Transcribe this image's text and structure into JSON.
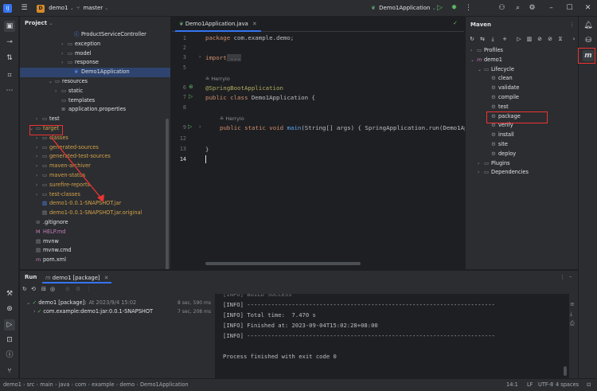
{
  "titlebar": {
    "app_icon": "ij-logo-icon",
    "project_badge": "D",
    "project_name": "demo1",
    "branch": "master",
    "run_config": "Demo1Application"
  },
  "project_panel": {
    "title": "Project",
    "rows": [
      {
        "label": "ProductServiceController",
        "indent": 7,
        "icon": "class-icon",
        "arrow": ""
      },
      {
        "label": "exception",
        "indent": 6,
        "icon": "folder-icon",
        "arrow": ">"
      },
      {
        "label": "model",
        "indent": 6,
        "icon": "folder-icon",
        "arrow": ">"
      },
      {
        "label": "response",
        "indent": 6,
        "icon": "folder-icon",
        "arrow": ">"
      },
      {
        "label": "Demo1Application",
        "indent": 7,
        "icon": "spring-class-icon",
        "arrow": "",
        "selected": true
      },
      {
        "label": "resources",
        "indent": 4,
        "icon": "folder-icon",
        "arrow": "v"
      },
      {
        "label": "static",
        "indent": 5,
        "icon": "folder-icon",
        "arrow": ">"
      },
      {
        "label": "templates",
        "indent": 5,
        "icon": "folder-icon",
        "arrow": ""
      },
      {
        "label": "application.properties",
        "indent": 5,
        "icon": "properties-icon",
        "arrow": ""
      },
      {
        "label": "test",
        "indent": 2,
        "icon": "folder-icon",
        "arrow": ">"
      },
      {
        "label": "target",
        "indent": 1,
        "icon": "folder-icon",
        "arrow": "v",
        "target": true
      },
      {
        "label": "classes",
        "indent": 2,
        "icon": "folder-icon",
        "arrow": ">",
        "target": true
      },
      {
        "label": "generated-sources",
        "indent": 2,
        "icon": "folder-icon",
        "arrow": ">",
        "target": true
      },
      {
        "label": "generated-test-sources",
        "indent": 2,
        "icon": "folder-icon",
        "arrow": ">",
        "target": true
      },
      {
        "label": "maven-archiver",
        "indent": 2,
        "icon": "folder-icon",
        "arrow": ">",
        "target": true
      },
      {
        "label": "maven-status",
        "indent": 2,
        "icon": "folder-icon",
        "arrow": ">",
        "target": true
      },
      {
        "label": "surefire-reports",
        "indent": 2,
        "icon": "folder-icon",
        "arrow": ">",
        "target": true
      },
      {
        "label": "test-classes",
        "indent": 2,
        "icon": "folder-icon",
        "arrow": ">",
        "target": true
      },
      {
        "label": "demo1-0.0.1-SNAPSHOT.jar",
        "indent": 2,
        "icon": "jar-icon",
        "arrow": "",
        "target": true
      },
      {
        "label": "demo1-0.0.1-SNAPSHOT.jar.original",
        "indent": 2,
        "icon": "file-icon",
        "arrow": "",
        "target": true
      },
      {
        "label": ".gitignore",
        "indent": 1,
        "icon": "gitignore-icon",
        "arrow": ""
      },
      {
        "label": "HELP.md",
        "indent": 1,
        "icon": "markdown-icon",
        "arrow": "",
        "help": true
      },
      {
        "label": "mvnw",
        "indent": 1,
        "icon": "file-icon",
        "arrow": ""
      },
      {
        "label": "mvnw.cmd",
        "indent": 1,
        "icon": "file-icon",
        "arrow": ""
      },
      {
        "label": "pom.xml",
        "indent": 1,
        "icon": "maven-icon",
        "arrow": ""
      }
    ]
  },
  "editor": {
    "tab_label": "Demo1Application.java",
    "line_numbers": [
      "1",
      "2",
      "3",
      "5",
      "6",
      "7",
      "8",
      "9",
      "12",
      "13",
      "14"
    ],
    "code": {
      "l1_kw": "package",
      "l1_rest": " com.example.demo;",
      "l3_kw": "import",
      "l3_fold": " ...",
      "author_hint1": "Herrylo",
      "l6_ann": "@SpringBootApplication",
      "l7_kw": "public class",
      "l7_rest": " Demo1Application {",
      "author_hint2": "Herrylo",
      "l9_kw": "public static void",
      "l9_fn": " main",
      "l9_rest": "(String[] args) { SpringApplication.run(Demo1Ap",
      "l13": "}"
    }
  },
  "maven": {
    "title": "Maven",
    "tree": [
      {
        "label": "Profiles",
        "arrow": ">",
        "icon": "folder-icon",
        "indent": 0
      },
      {
        "label": "demo1",
        "arrow": "v",
        "icon": "maven-icon",
        "indent": 0
      },
      {
        "label": "Lifecycle",
        "arrow": "v",
        "icon": "folder-icon",
        "indent": 1
      },
      {
        "label": "clean",
        "arrow": "",
        "icon": "gear-icon",
        "indent": 2
      },
      {
        "label": "validate",
        "arrow": "",
        "icon": "gear-icon",
        "indent": 2
      },
      {
        "label": "compile",
        "arrow": "",
        "icon": "gear-icon",
        "indent": 2
      },
      {
        "label": "test",
        "arrow": "",
        "icon": "gear-icon",
        "indent": 2
      },
      {
        "label": "package",
        "arrow": "",
        "icon": "gear-icon",
        "indent": 2,
        "selected": true
      },
      {
        "label": "verify",
        "arrow": "",
        "icon": "gear-icon",
        "indent": 2
      },
      {
        "label": "install",
        "arrow": "",
        "icon": "gear-icon",
        "indent": 2
      },
      {
        "label": "site",
        "arrow": "",
        "icon": "gear-icon",
        "indent": 2
      },
      {
        "label": "deploy",
        "arrow": "",
        "icon": "gear-icon",
        "indent": 2
      },
      {
        "label": "Plugins",
        "arrow": ">",
        "icon": "folder-icon",
        "indent": 1
      },
      {
        "label": "Dependencies",
        "arrow": ">",
        "icon": "folder-icon",
        "indent": 1
      }
    ]
  },
  "run": {
    "title": "Run",
    "tab_label": "demo1 [package]",
    "tree": [
      {
        "label": "demo1 [package]:",
        "meta": "At 2023/9/4 15:02",
        "time": "8 sec, 590 ms"
      },
      {
        "label": "com.example:demo1:jar:0.0.1-SNAPSHOT",
        "meta": "",
        "time": "7 sec, 208 ms"
      }
    ],
    "console": [
      "[INFO] BUILD SUCCESS",
      "[INFO] ------------------------------------------------------------------------",
      "[INFO] Total time:  7.470 s",
      "[INFO] Finished at: 2023-09-04T15:02:28+08:00",
      "[INFO] ------------------------------------------------------------------------",
      "",
      "Process finished with exit code 0"
    ]
  },
  "statusbar": {
    "breadcrumbs": [
      "demo1",
      "src",
      "main",
      "java",
      "com",
      "example",
      "demo",
      "Demo1Application"
    ],
    "position": "14:1",
    "line_sep": "LF",
    "encoding": "UTF-8",
    "indent": "4 spaces"
  },
  "colors": {
    "highlight_box": "#ee3333",
    "selection": "#2e436e",
    "target_folder": "#d5a14a"
  }
}
